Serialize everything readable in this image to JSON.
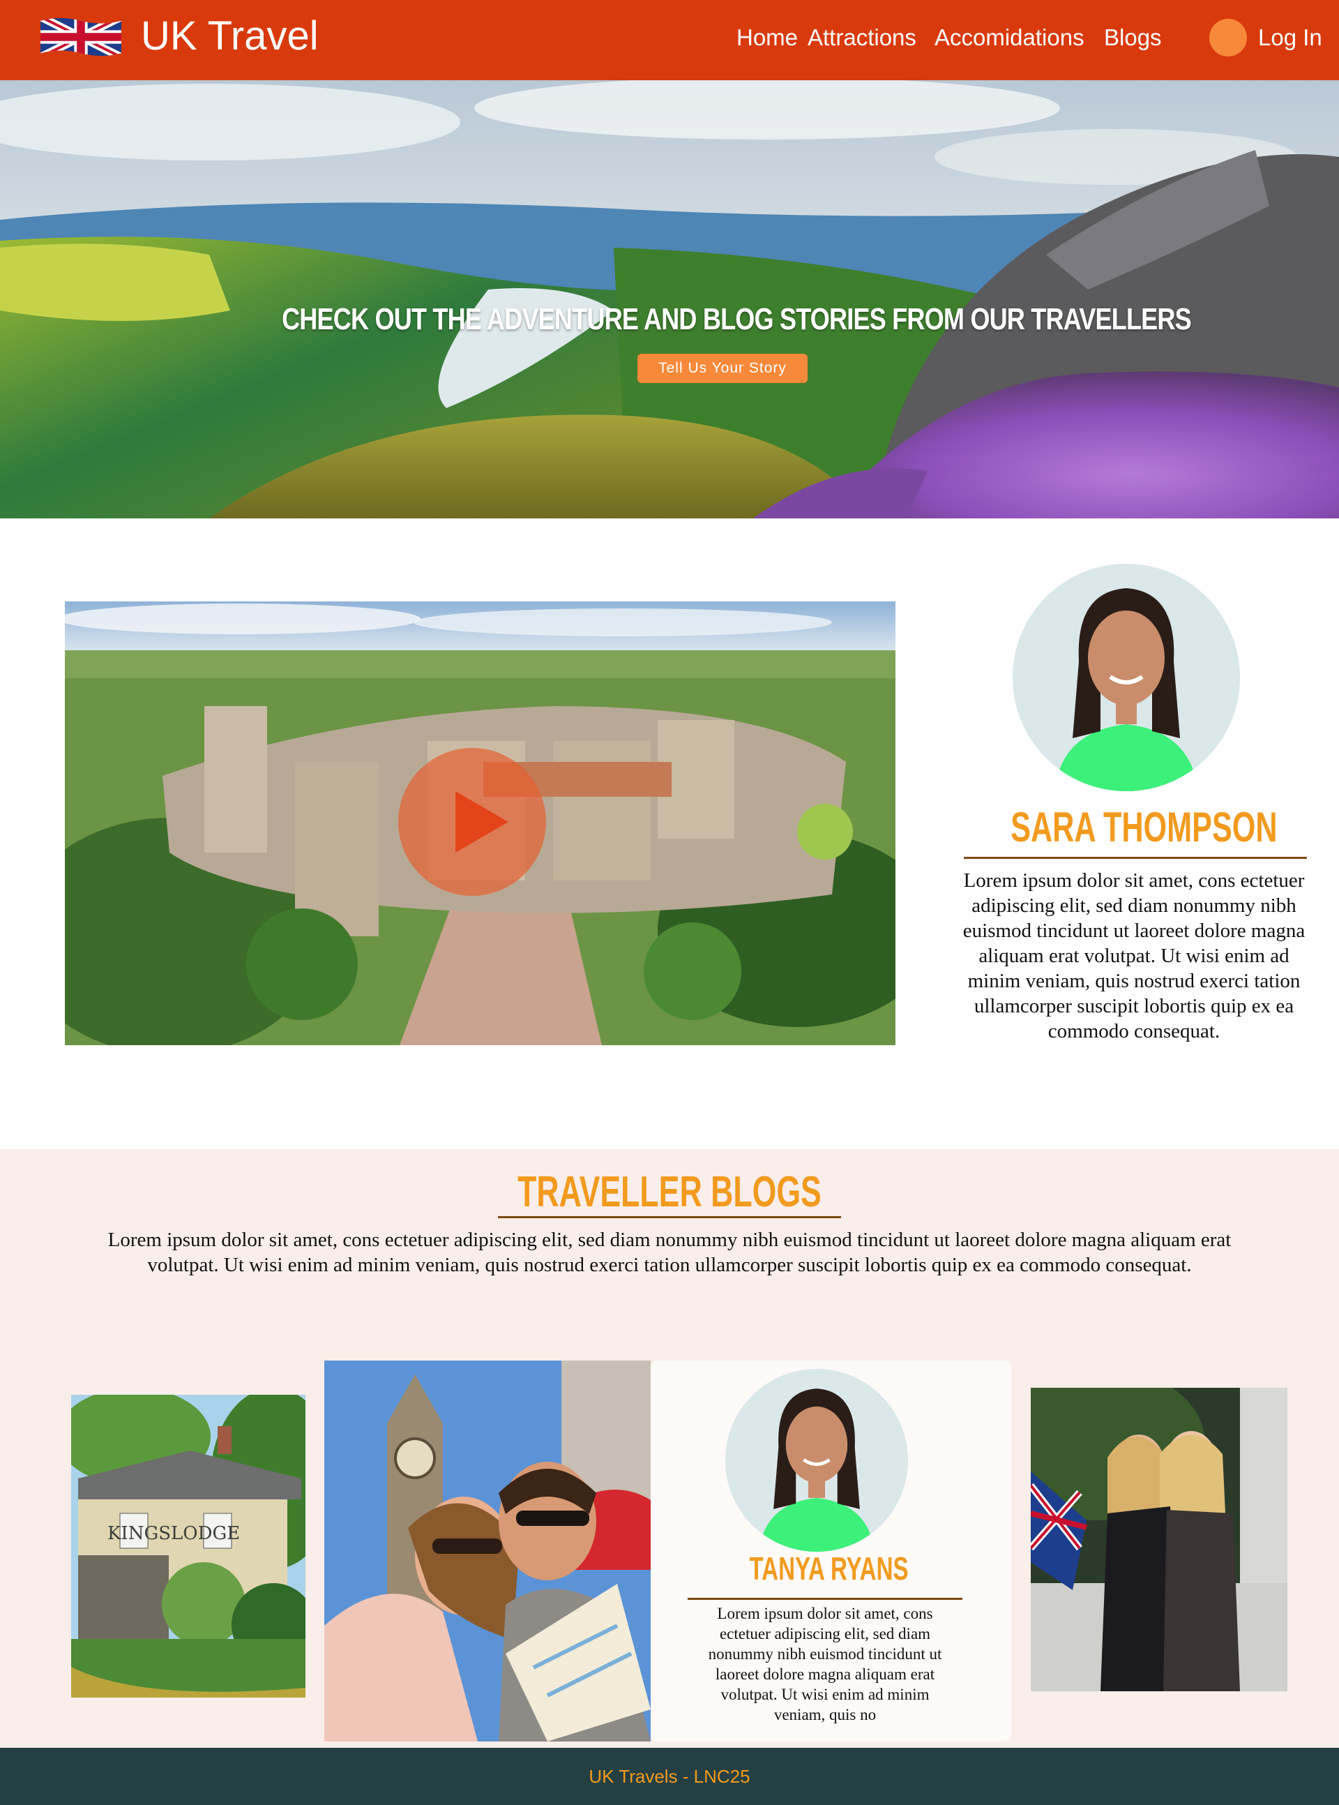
{
  "nav": {
    "brand": "UK Travel",
    "links": [
      "Home",
      "Attractions",
      "Accomidations",
      "Blogs"
    ],
    "login": "Log In"
  },
  "hero": {
    "title": "CHECK OUT THE ADVENTURE AND BLOG STORIES FROM OUR TRAVELLERS",
    "button": "Tell Us Your Story"
  },
  "feature": {
    "author_name": "SARA THOMPSON",
    "author_bio": "Lorem ipsum dolor sit amet, cons ectetuer adipiscing elit, sed diam nonummy nibh euismod tincidunt ut laoreet dolore magna aliquam erat volutpat. Ut wisi enim ad minim veniam, quis nostrud exerci tation ullamcorper suscipit lobortis quip ex ea commodo consequat."
  },
  "blogs": {
    "title": "TRAVELLER BLOGS",
    "intro": "Lorem ipsum dolor sit amet, cons ectetuer adipiscing elit, sed diam nonummy nibh euismod tincidunt ut laoreet dolore magna aliquam erat volutpat. Ut wisi enim ad minim veniam, quis nostrud exerci tation ullamcorper suscipit lobortis quip ex ea commodo consequat.",
    "card": {
      "name": "TANYA RYANS",
      "text": "Lorem ipsum dolor sit amet, cons ectetuer adipiscing elit, sed diam nonummy nibh euismod tincidunt ut laoreet dolore magna aliquam erat volutpat. Ut wisi enim ad minim veniam, quis no"
    },
    "photos": [
      {
        "image": "cottage-photo",
        "sign": "KINGSLODGE"
      },
      {
        "image": "couple-big-ben-photo"
      },
      {
        "image": "friends-flag-photo"
      }
    ]
  },
  "footer": {
    "text": "UK Travels - LNC25"
  },
  "icons": {
    "flag": "uk-flag-icon",
    "login": "login-dot-icon",
    "play": "play-icon"
  },
  "colors": {
    "nav_bg": "#d93a0b",
    "accent": "#f7893a",
    "heading": "#f29a1e",
    "rule": "#7a4a0c",
    "blogs_bg": "#faeeea",
    "footer_bg": "#254043"
  }
}
